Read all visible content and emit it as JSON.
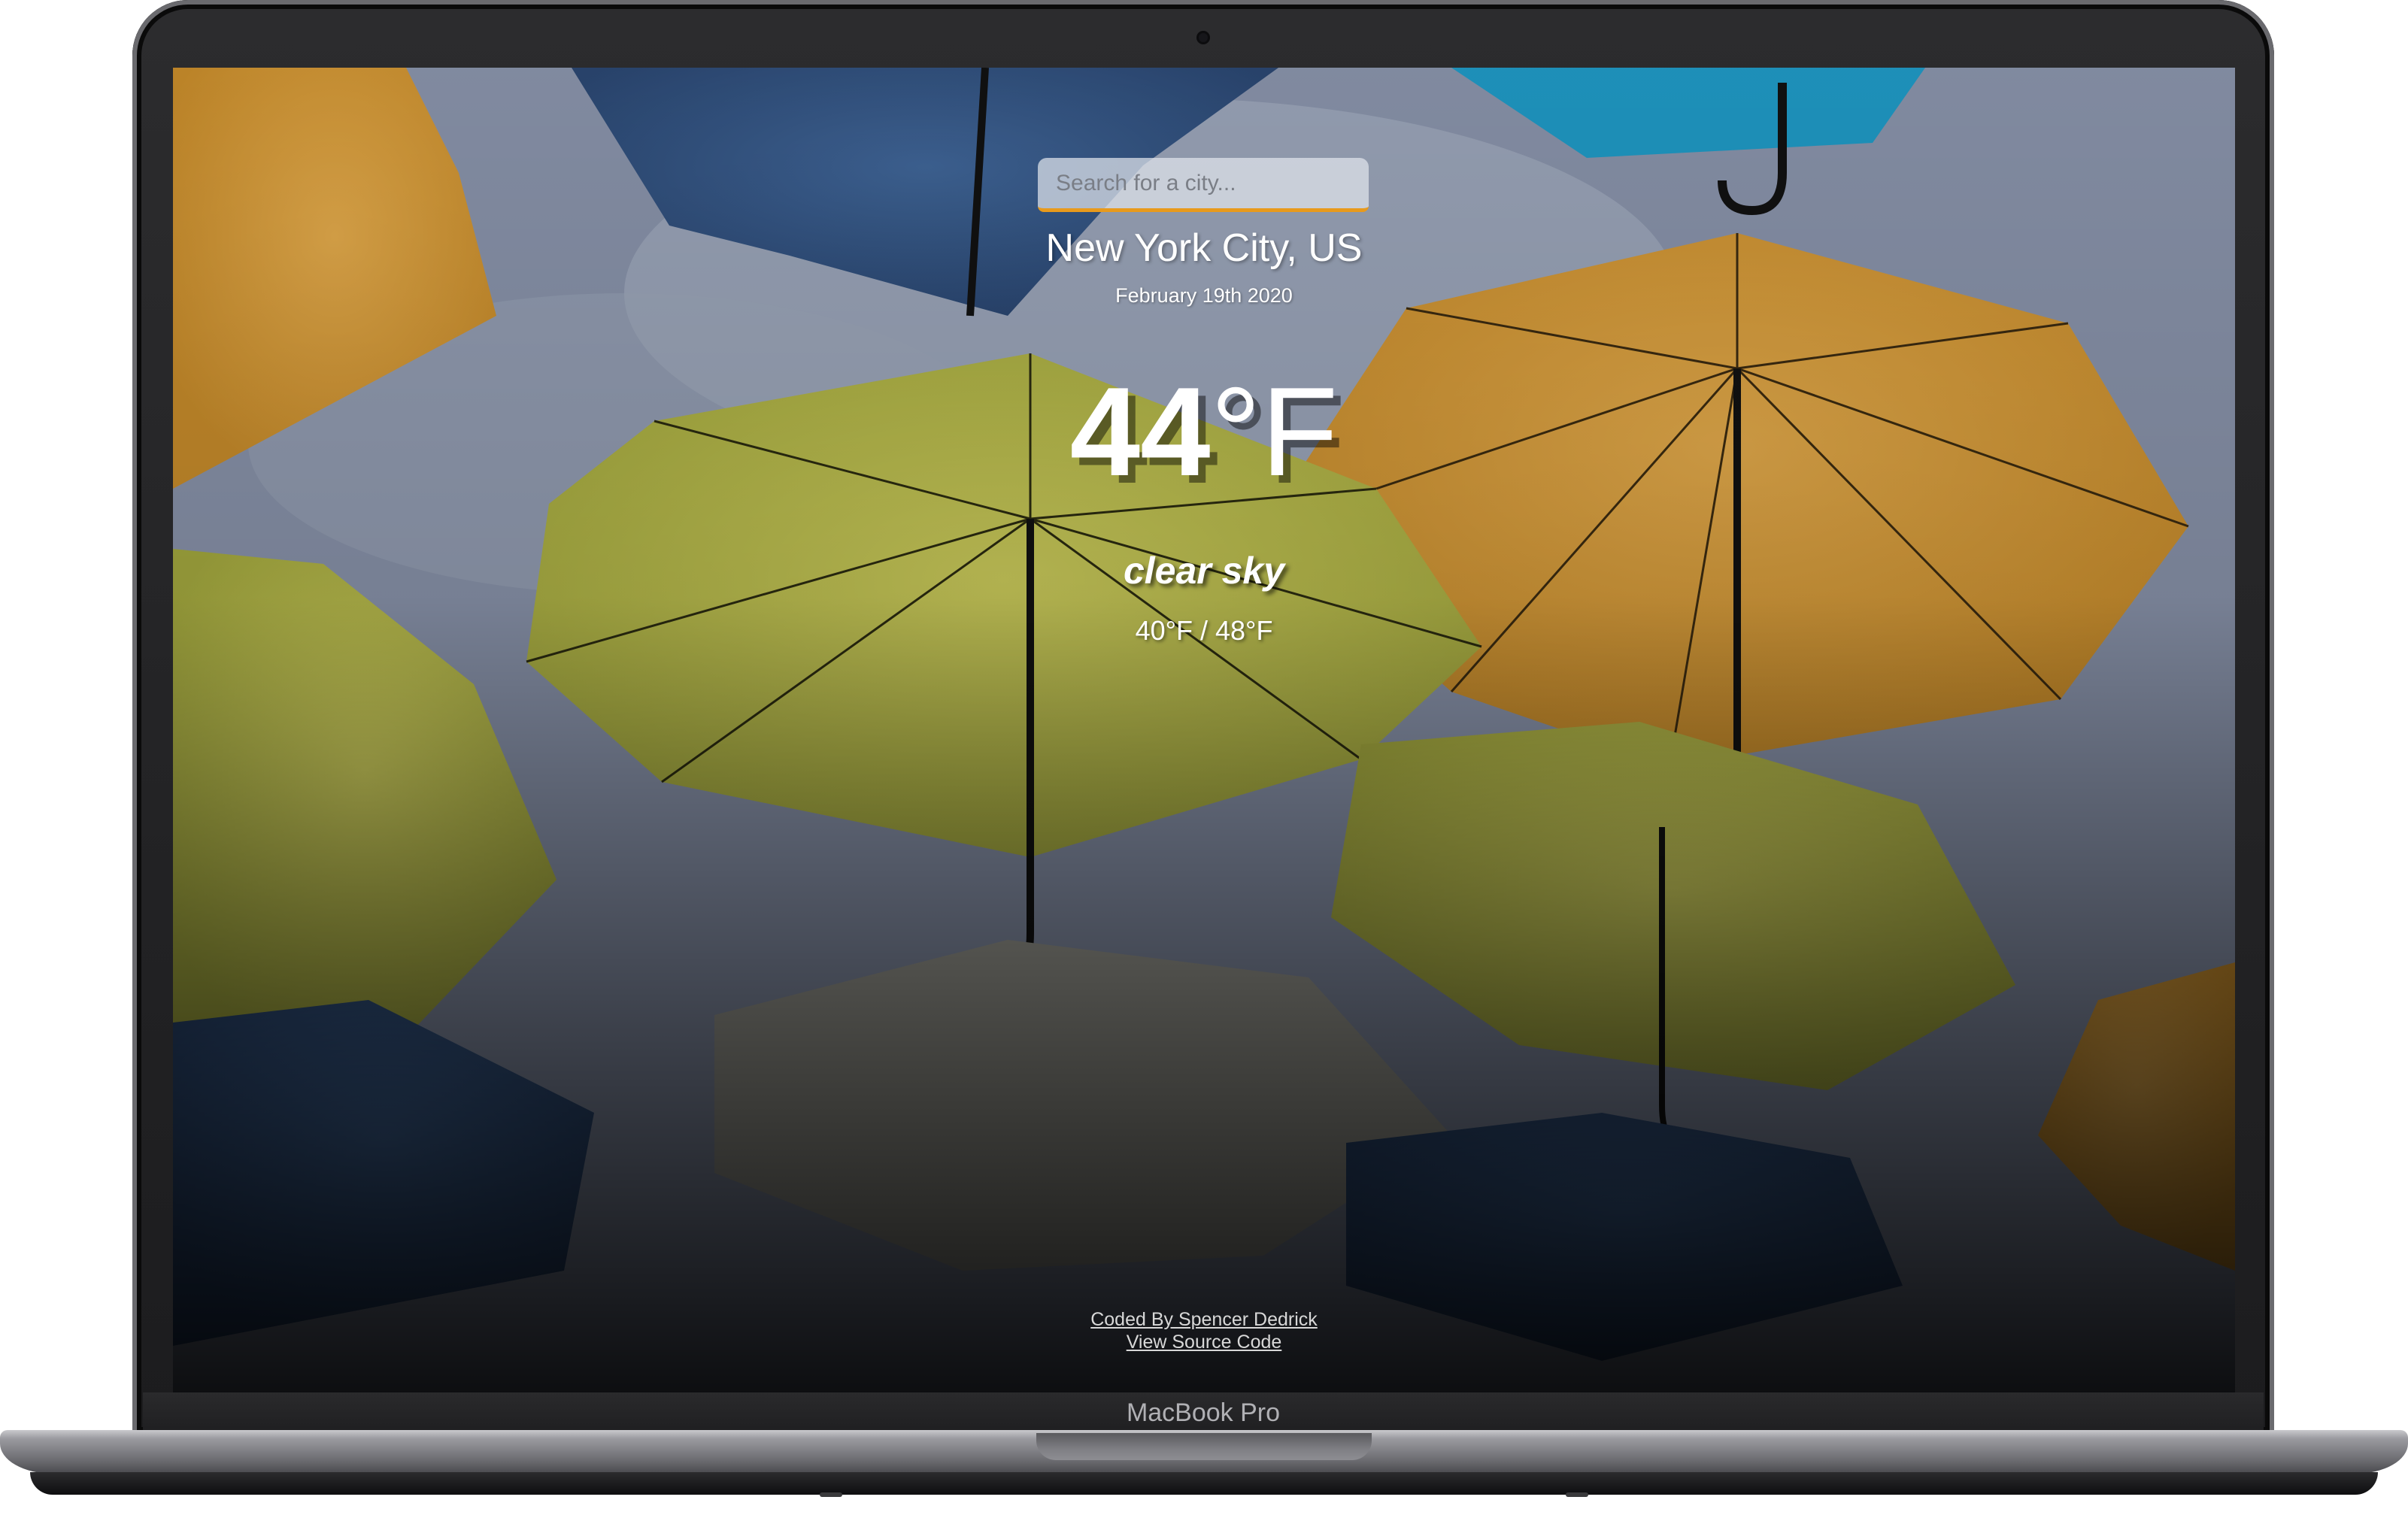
{
  "device": {
    "brand_label": "MacBook Pro"
  },
  "weather_app": {
    "search": {
      "placeholder": "Search for a city...",
      "value": ""
    },
    "location": "New York City, US",
    "date": "February 19th 2020",
    "temperature": {
      "value": "44",
      "unit": "°F"
    },
    "description": "clear sky",
    "range": "40°F / 48°F",
    "footer": {
      "credit_link": "Coded By Spencer Dedrick",
      "source_link": "View Source Code"
    },
    "background": {
      "theme": "umbrellas",
      "colors": {
        "sky": "#8390a6",
        "umbrella_yellow": "#cfcf4e",
        "umbrella_orange": "#e8a830",
        "umbrella_blue": "#3c5e8e",
        "umbrella_cyan": "#1e9cc8"
      }
    },
    "accent_color": "#e89a1c"
  }
}
